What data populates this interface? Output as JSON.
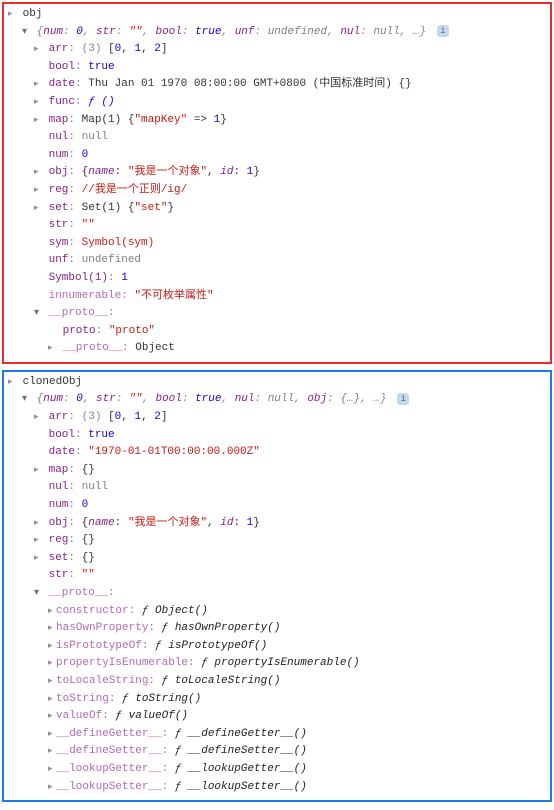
{
  "obj_panel": {
    "var_name": "obj",
    "summary_prefix": "{",
    "summary_parts": [
      {
        "k": "num",
        "v": "0",
        "cls": "v"
      },
      {
        "k": "str",
        "v": "\"\"",
        "cls": "vs"
      },
      {
        "k": "bool",
        "v": "true",
        "cls": "v"
      },
      {
        "k": "unf",
        "v": "undefined",
        "cls": "vg"
      },
      {
        "k": "nul",
        "v": "null",
        "cls": "vg"
      }
    ],
    "summary_suffix": ", …}",
    "arr_label": "arr",
    "arr_len": "(3)",
    "arr_preview": "[0, 1, 2]",
    "bool_label": "bool",
    "bool_val": "true",
    "date_label": "date",
    "date_val": "Thu Jan 01 1970 08:00:00 GMT+0800 (中国标准时间) {}",
    "func_label": "func",
    "func_f": "ƒ ()",
    "map_label": "map",
    "map_val": "Map(1) {\"mapKey\" => 1}",
    "nul_label": "nul",
    "nul_val": "null",
    "num_label": "num",
    "num_val": "0",
    "obj_label": "obj",
    "obj_name_k": "name",
    "obj_name_v": "\"我是一个对象\"",
    "obj_id_k": "id",
    "obj_id_v": "1",
    "reg_label": "reg",
    "reg_val": "//我是一个正则/ig/",
    "set_label": "set",
    "set_val": "Set(1) {\"set\"}",
    "str_label": "str",
    "str_val": "\"\"",
    "sym_label": "sym",
    "sym_val": "Symbol(sym)",
    "unf_label": "unf",
    "unf_val": "undefined",
    "sym1_label": "Symbol(1)",
    "sym1_val": "1",
    "innum_label": "innumerable",
    "innum_val": "\"不可枚举属性\"",
    "proto_label": "__proto__",
    "proto_k": "proto",
    "proto_v": "\"proto\"",
    "proto_inner_label": "__proto__",
    "proto_inner_val": "Object"
  },
  "cloned_panel": {
    "var_name": "clonedObj",
    "summary_parts": [
      {
        "k": "num",
        "v": "0",
        "cls": "v"
      },
      {
        "k": "str",
        "v": "\"\"",
        "cls": "vs"
      },
      {
        "k": "bool",
        "v": "true",
        "cls": "v"
      },
      {
        "k": "nul",
        "v": "null",
        "cls": "vg"
      },
      {
        "k": "obj",
        "v": "{…}",
        "cls": "vg"
      }
    ],
    "summary_suffix": ", …}",
    "arr_label": "arr",
    "arr_len": "(3)",
    "arr_preview": "[0, 1, 2]",
    "bool_label": "bool",
    "bool_val": "true",
    "date_label": "date",
    "date_val": "\"1970-01-01T00:00:00.000Z\"",
    "map_label": "map",
    "map_val": "{}",
    "nul_label": "nul",
    "nul_val": "null",
    "num_label": "num",
    "num_val": "0",
    "obj_label": "obj",
    "obj_name_k": "name",
    "obj_name_v": "\"我是一个对象\"",
    "obj_id_k": "id",
    "obj_id_v": "1",
    "reg_label": "reg",
    "reg_val": "{}",
    "set_label": "set",
    "set_val": "{}",
    "str_label": "str",
    "str_val": "\"\"",
    "proto_label": "__proto__",
    "proto_methods": [
      {
        "k": "constructor",
        "v": "ƒ Object()"
      },
      {
        "k": "hasOwnProperty",
        "v": "ƒ hasOwnProperty()"
      },
      {
        "k": "isPrototypeOf",
        "v": "ƒ isPrototypeOf()"
      },
      {
        "k": "propertyIsEnumerable",
        "v": "ƒ propertyIsEnumerable()"
      },
      {
        "k": "toLocaleString",
        "v": "ƒ toLocaleString()"
      },
      {
        "k": "toString",
        "v": "ƒ toString()"
      },
      {
        "k": "valueOf",
        "v": "ƒ valueOf()"
      },
      {
        "k": "__defineGetter__",
        "v": "ƒ __defineGetter__()"
      },
      {
        "k": "__defineSetter__",
        "v": "ƒ __defineSetter__()"
      },
      {
        "k": "__lookupGetter__",
        "v": "ƒ __lookupGetter__()"
      },
      {
        "k": "__lookupSetter__",
        "v": "ƒ __lookupSetter__()"
      }
    ]
  }
}
